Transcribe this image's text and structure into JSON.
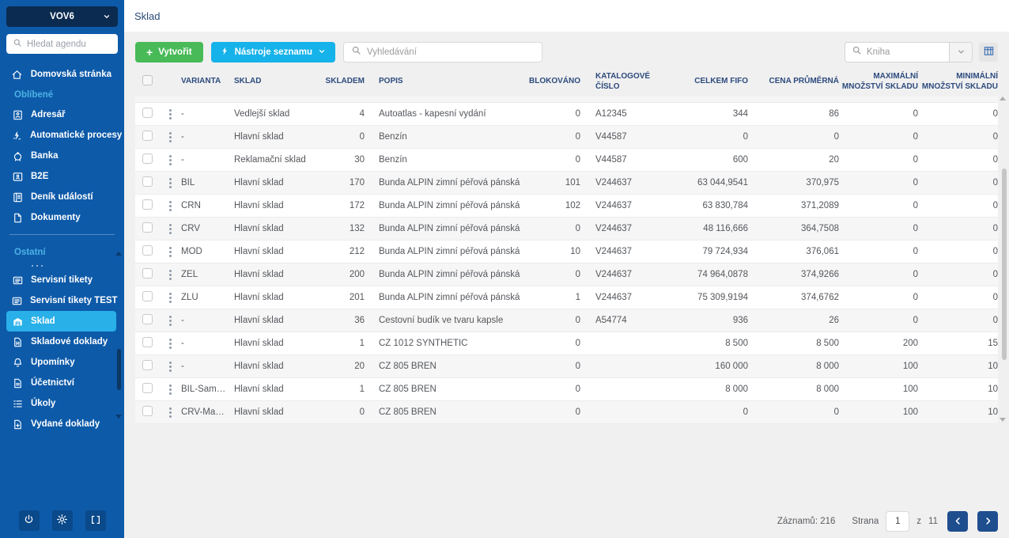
{
  "sidebar": {
    "workspace_label": "VOV6",
    "search_placeholder": "Hledat agendu",
    "nav": [
      {
        "type": "item",
        "icon": "home-icon",
        "label": "Domovská stránka"
      },
      {
        "type": "section",
        "label": "Oblíbené"
      },
      {
        "type": "item",
        "icon": "address-book-icon",
        "label": "Adresář"
      },
      {
        "type": "item",
        "icon": "automation-icon",
        "label": "Automatické procesy"
      },
      {
        "type": "item",
        "icon": "bank-icon",
        "label": "Banka"
      },
      {
        "type": "item",
        "icon": "b2e-icon",
        "label": "B2E"
      },
      {
        "type": "item",
        "icon": "journal-icon",
        "label": "Deník událostí"
      },
      {
        "type": "item",
        "icon": "documents-icon",
        "label": "Dokumenty"
      },
      {
        "type": "divider"
      },
      {
        "type": "section",
        "label": "Ostatní"
      },
      {
        "type": "partial"
      },
      {
        "type": "item",
        "icon": "service-tickets-icon",
        "label": "Servisní tikety"
      },
      {
        "type": "item",
        "icon": "service-tickets-icon",
        "label": "Servisní tikety TEST"
      },
      {
        "type": "item",
        "icon": "warehouse-icon",
        "label": "Sklad",
        "active": true
      },
      {
        "type": "item",
        "icon": "stock-docs-icon",
        "label": "Skladové doklady"
      },
      {
        "type": "item",
        "icon": "bell-icon",
        "label": "Upomínky"
      },
      {
        "type": "item",
        "icon": "accounting-icon",
        "label": "Účetnictví"
      },
      {
        "type": "item",
        "icon": "tasks-icon",
        "label": "Úkoly"
      },
      {
        "type": "item",
        "icon": "issued-docs-icon",
        "label": "Vydané doklady"
      }
    ]
  },
  "header": {
    "title": "Sklad"
  },
  "toolbar": {
    "create_label": "Vytvořit",
    "tools_label": "Nástroje seznamu",
    "search_placeholder": "Vyhledávání",
    "book_placeholder": "Kniha"
  },
  "table": {
    "columns": [
      "VARIANTA",
      "SKLAD",
      "SKLADEM",
      "POPIS",
      "BLOKOVÁNO",
      "KATALOGOVÉ ČÍSLO",
      "CELKEM FIFO",
      "CENA PRŮMĚRNÁ",
      "MAXIMÁLNÍ MNOŽSTVÍ SKLADU",
      "MINIMÁLNÍ MNOŽSTVÍ SKLADU"
    ],
    "rows": [
      {
        "varianta": "-",
        "sklad": "Vedlejší sklad",
        "skladem": "4",
        "popis": "Autoatlas - kapesní vydání",
        "blokovano": "0",
        "katalog": "A12345",
        "fifo": "344",
        "cena": "86",
        "max": "0",
        "min": "0"
      },
      {
        "varianta": "-",
        "sklad": "Hlavní sklad",
        "skladem": "0",
        "popis": "Benzín",
        "blokovano": "0",
        "katalog": "V44587",
        "fifo": "0",
        "cena": "0",
        "max": "0",
        "min": "0"
      },
      {
        "varianta": "-",
        "sklad": "Reklamační sklad",
        "skladem": "30",
        "popis": "Benzín",
        "blokovano": "0",
        "katalog": "V44587",
        "fifo": "600",
        "cena": "20",
        "max": "0",
        "min": "0"
      },
      {
        "varianta": "BÍL",
        "sklad": "Hlavní sklad",
        "skladem": "170",
        "popis": "Bunda ALPIN zimní péřová pánská",
        "blokovano": "101",
        "katalog": "V244637",
        "fifo": "63 044,9541",
        "cena": "370,975",
        "max": "0",
        "min": "0"
      },
      {
        "varianta": "ČRN",
        "sklad": "Hlavní sklad",
        "skladem": "172",
        "popis": "Bunda ALPIN zimní péřová pánská",
        "blokovano": "102",
        "katalog": "V244637",
        "fifo": "63 830,784",
        "cena": "371,2089",
        "max": "0",
        "min": "0"
      },
      {
        "varianta": "ČRV",
        "sklad": "Hlavní sklad",
        "skladem": "132",
        "popis": "Bunda ALPIN zimní péřová pánská",
        "blokovano": "0",
        "katalog": "V244637",
        "fifo": "48 116,666",
        "cena": "364,7508",
        "max": "0",
        "min": "0"
      },
      {
        "varianta": "MOD",
        "sklad": "Hlavní sklad",
        "skladem": "212",
        "popis": "Bunda ALPIN zimní péřová pánská",
        "blokovano": "10",
        "katalog": "V244637",
        "fifo": "79 724,934",
        "cena": "376,061",
        "max": "0",
        "min": "0"
      },
      {
        "varianta": "ZEL",
        "sklad": "Hlavní sklad",
        "skladem": "200",
        "popis": "Bunda ALPIN zimní péřová pánská",
        "blokovano": "0",
        "katalog": "V244637",
        "fifo": "74 964,0878",
        "cena": "374,9266",
        "max": "0",
        "min": "0"
      },
      {
        "varianta": "ŽLU",
        "sklad": "Hlavní sklad",
        "skladem": "201",
        "popis": "Bunda ALPIN zimní péřová pánská",
        "blokovano": "1",
        "katalog": "V244637",
        "fifo": "75 309,9194",
        "cena": "374,6762",
        "max": "0",
        "min": "0"
      },
      {
        "varianta": "-",
        "sklad": "Hlavní sklad",
        "skladem": "36",
        "popis": "Cestovní budík ve tvaru kapsle",
        "blokovano": "0",
        "katalog": "A54774",
        "fifo": "936",
        "cena": "26",
        "max": "0",
        "min": "0"
      },
      {
        "varianta": "-",
        "sklad": "Hlavní sklad",
        "skladem": "1",
        "popis": "CZ 1012 SYNTHETIC",
        "blokovano": "0",
        "katalog": "",
        "fifo": "8 500",
        "cena": "8 500",
        "max": "200",
        "min": "15"
      },
      {
        "varianta": "-",
        "sklad": "Hlavní sklad",
        "skladem": "20",
        "popis": "CZ 805 BREN",
        "blokovano": "0",
        "katalog": "",
        "fifo": "160 000",
        "cena": "8 000",
        "max": "100",
        "min": "10"
      },
      {
        "varianta": "BÍL-Sam…",
        "sklad": "Hlavní sklad",
        "skladem": "1",
        "popis": "CZ 805 BREN",
        "blokovano": "0",
        "katalog": "",
        "fifo": "8 000",
        "cena": "8 000",
        "max": "100",
        "min": "10"
      },
      {
        "varianta": "ČRV-Ma…",
        "sklad": "Hlavní sklad",
        "skladem": "0",
        "popis": "CZ 805 BREN",
        "blokovano": "0",
        "katalog": "",
        "fifo": "0",
        "cena": "0",
        "max": "100",
        "min": "10"
      }
    ]
  },
  "pagination": {
    "records_label": "Záznamů: 216",
    "page_label": "Strana",
    "page_value": "1",
    "of_label": "z",
    "total_pages": "11"
  },
  "colors": {
    "sidebar": "#0d5aa9",
    "active_item": "#29b0e8",
    "create_button": "#48ba58",
    "tools_button": "#16b2ea",
    "pager_button": "#1f4e8f",
    "header_text": "#2d4b7e"
  }
}
